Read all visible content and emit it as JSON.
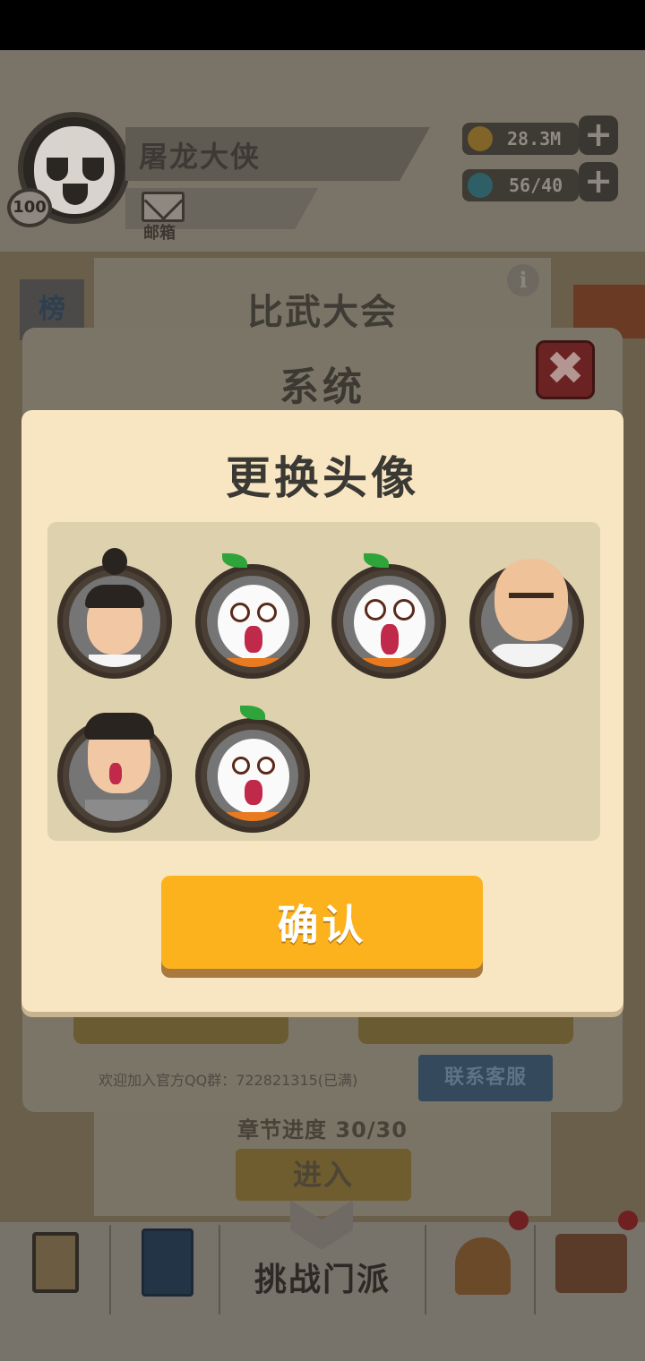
{
  "header": {
    "player_name": "屠龙大侠",
    "level": "100",
    "mail_label": "邮箱",
    "resources": [
      {
        "icon": "coin-icon",
        "value": "28.3M"
      },
      {
        "icon": "stamina-drop-icon",
        "value": "56/40"
      }
    ]
  },
  "background": {
    "panel_title": "比武大会",
    "side_tab_label": "榜",
    "chapter_progress": "章节进度 30/30",
    "enter_label": "进入"
  },
  "system_dialog": {
    "title": "系统",
    "qq_group_text": "欢迎加入官方QQ群：722821315(已满)",
    "contact_service_label": "联系客服"
  },
  "modal": {
    "title": "更换头像",
    "confirm_label": "确认",
    "avatar_options": [
      {
        "name": "topknot-man"
      },
      {
        "name": "radish-blush"
      },
      {
        "name": "radish-shock"
      },
      {
        "name": "bald-man"
      },
      {
        "name": "pointing-man"
      },
      {
        "name": "radish-worried"
      }
    ]
  },
  "bottom_nav": {
    "items": [
      {
        "icon": "task-scroll-icon"
      },
      {
        "icon": "training-book-icon"
      },
      {
        "label": "挑战门派"
      },
      {
        "icon": "helmet-icon"
      },
      {
        "icon": "collect-shop-icon"
      }
    ]
  }
}
